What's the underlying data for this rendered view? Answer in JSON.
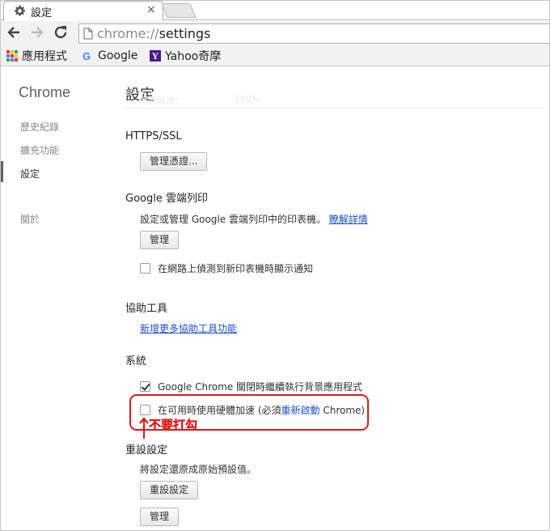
{
  "browser": {
    "tab_title": "設定",
    "tab_close": "×",
    "url_scheme": "chrome://",
    "url_path": "settings"
  },
  "bookmarks": [
    {
      "label": "應用程式",
      "icon": "apps-grid-icon"
    },
    {
      "label": "Google",
      "icon": "google-g-icon"
    },
    {
      "label": "Yahoo奇摩",
      "icon": "yahoo-y-icon"
    }
  ],
  "sidebar": {
    "brand": "Chrome",
    "items": [
      {
        "label": "歷史紀錄",
        "active": false
      },
      {
        "label": "擴充功能",
        "active": false
      },
      {
        "label": "設定",
        "active": true
      },
      {
        "label": "關於",
        "active": false
      }
    ]
  },
  "page": {
    "title": "設定",
    "ghost_left": "網頁縮放：",
    "ghost_right": "100%"
  },
  "https_ssl": {
    "title": "HTTPS/SSL",
    "manage_certs_button": "管理憑證..."
  },
  "cloud_print": {
    "title": "Google 雲端列印",
    "description": "設定或管理 Google 雲端列印中的印表機。",
    "learn_more": "瞭解詳情",
    "manage_button": "管理",
    "notify_checkbox": "在網路上偵測到新印表機時顯示通知",
    "notify_checked": false
  },
  "accessibility": {
    "title": "協助工具",
    "add_link": "新增更多協助工具功能"
  },
  "system": {
    "title": "系統",
    "background_apps": "Google Chrome 關閉時繼續執行背景應用程式",
    "background_apps_checked": true,
    "hw_accel_prefix": "在可用時使用硬體加速 (必須",
    "hw_accel_link": "重新啟動",
    "hw_accel_suffix": " Chrome)",
    "hw_accel_checked": false
  },
  "annotation": {
    "text": "不要打勾",
    "color": "#e0181a"
  },
  "reset": {
    "title": "重設設定",
    "description": "將設定還原成原始預設值。",
    "reset_button": "重設設定",
    "manage_button": "管理"
  }
}
